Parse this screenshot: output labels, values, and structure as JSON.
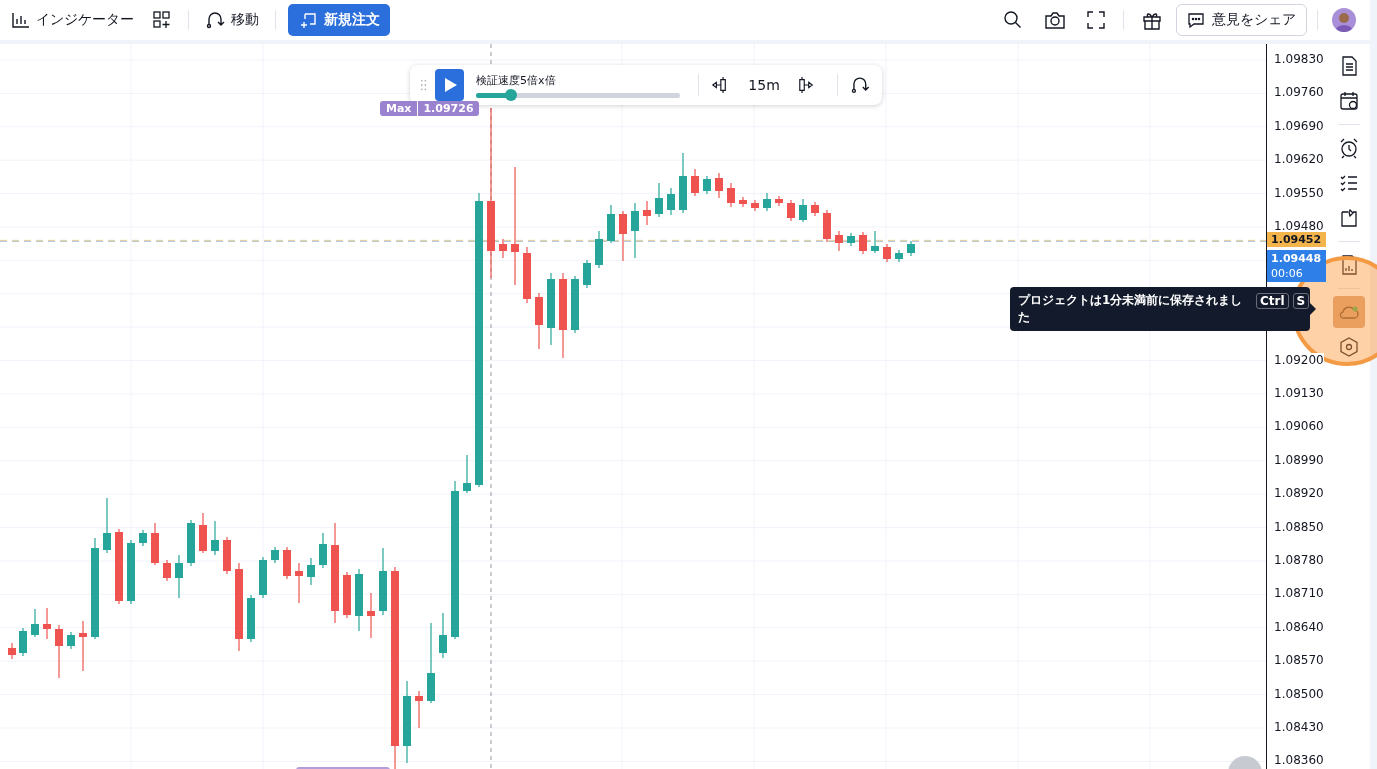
{
  "toolbar": {
    "indicators_button": "インジケーター",
    "move_button": "移動",
    "new_order_button": "新規注文",
    "feedback_button": "意見をシェア"
  },
  "replay": {
    "speed_label": "検証速度5倍x倍",
    "speed_slider": {
      "level": 0.17
    },
    "interval": "15m"
  },
  "chart": {
    "price_axis": [
      "1.09830",
      "1.09760",
      "1.09690",
      "1.09620",
      "1.09550",
      "1.09480",
      "1.09200",
      "1.09130",
      "1.09060",
      "1.08990",
      "1.08920",
      "1.08850",
      "1.08780",
      "1.08710",
      "1.08640",
      "1.08570",
      "1.08500",
      "1.08430",
      "1.08360"
    ],
    "max_label": {
      "tag": "Max",
      "value": "1.09726"
    },
    "price_labels": [
      {
        "value": "1.09452",
        "color": "#f2b44b"
      },
      {
        "value": "1.09448",
        "countdown": "00:06",
        "color": "#2f7fe8"
      }
    ]
  },
  "tooltip": {
    "text": "プロジェクトは1分未満前に保存されました",
    "keys": [
      "Ctrl",
      "S"
    ]
  },
  "sidebar": {
    "groups": [
      {
        "items": [
          {
            "kind": "document",
            "selected": false
          },
          {
            "kind": "calendar",
            "selected": false
          }
        ]
      },
      {
        "items": [
          {
            "kind": "alarm",
            "selected": false
          },
          {
            "kind": "checklist",
            "selected": false
          },
          {
            "kind": "note",
            "selected": false
          }
        ]
      },
      {
        "items": [
          {
            "kind": "report",
            "selected": false
          }
        ]
      },
      {
        "items": [
          {
            "kind": "cloud",
            "selected": true
          },
          {
            "kind": "hexagon",
            "selected": false
          }
        ]
      }
    ]
  }
}
